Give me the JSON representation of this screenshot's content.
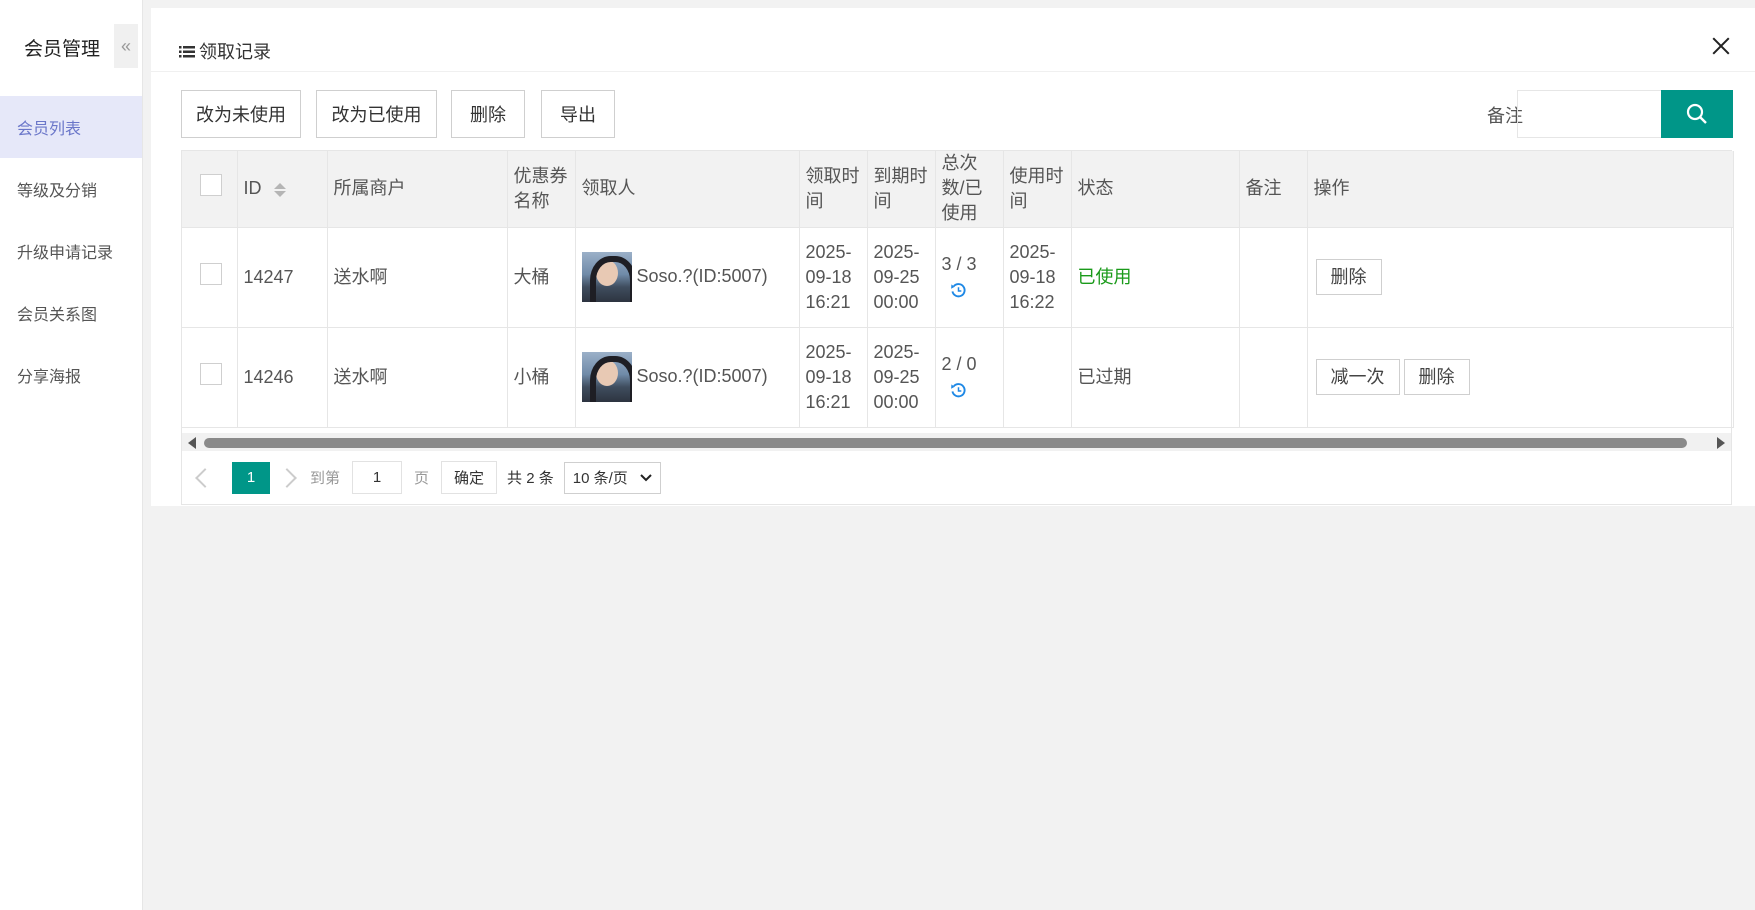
{
  "sidebar": {
    "title": "会员管理",
    "collapse_glyph": "«",
    "items": [
      {
        "label": "会员列表",
        "active": true
      },
      {
        "label": "等级及分销"
      },
      {
        "label": "升级申请记录"
      },
      {
        "label": "会员关系图"
      },
      {
        "label": "分享海报"
      }
    ]
  },
  "panel": {
    "title": "领取记录"
  },
  "toolbar": {
    "btn_mark_unused": "改为未使用",
    "btn_mark_used": "改为已使用",
    "btn_delete": "删除",
    "btn_export": "导出",
    "search_label": "备注",
    "search_value": "",
    "search_icon": "search-icon"
  },
  "table": {
    "headers": {
      "id": "ID",
      "merchant": "所属商户",
      "coupon_name": "优惠券名称",
      "receiver": "领取人",
      "receive_time": "领取时间",
      "expire_time": "到期时间",
      "count": "总次数/已使用",
      "use_time": "使用时间",
      "status": "状态",
      "remark": "备注",
      "actions": "操作"
    },
    "rows": [
      {
        "id": "14247",
        "merchant": "送水啊",
        "coupon_name": "大桶",
        "receiver": "Soso.?(ID:5007)",
        "receive_time": "2025-09-18 16:21",
        "expire_time": "2025-09-25 00:00",
        "count": "3 / 3",
        "use_time": "2025-09-18 16:22",
        "status": "已使用",
        "remark": "",
        "action_minus": "",
        "action_delete": "删除"
      },
      {
        "id": "14246",
        "merchant": "送水啊",
        "coupon_name": "小桶",
        "receiver": "Soso.?(ID:5007)",
        "receive_time": "2025-09-18 16:21",
        "expire_time": "2025-09-25 00:00",
        "count": "2 / 0",
        "use_time": "",
        "status": "已过期",
        "remark": "",
        "action_minus": "减一次",
        "action_delete": "删除"
      }
    ]
  },
  "pagination": {
    "current": "1",
    "goto_label": "到第",
    "goto_value": "1",
    "page_unit": "页",
    "confirm": "确定",
    "total": "共 2 条",
    "page_size": "10 条/页"
  },
  "colors": {
    "accent": "#009688",
    "status_used": "#1a9a1a",
    "sidebar_active_bg": "#e6e8f9",
    "refresh_icon": "#1e88e5"
  }
}
